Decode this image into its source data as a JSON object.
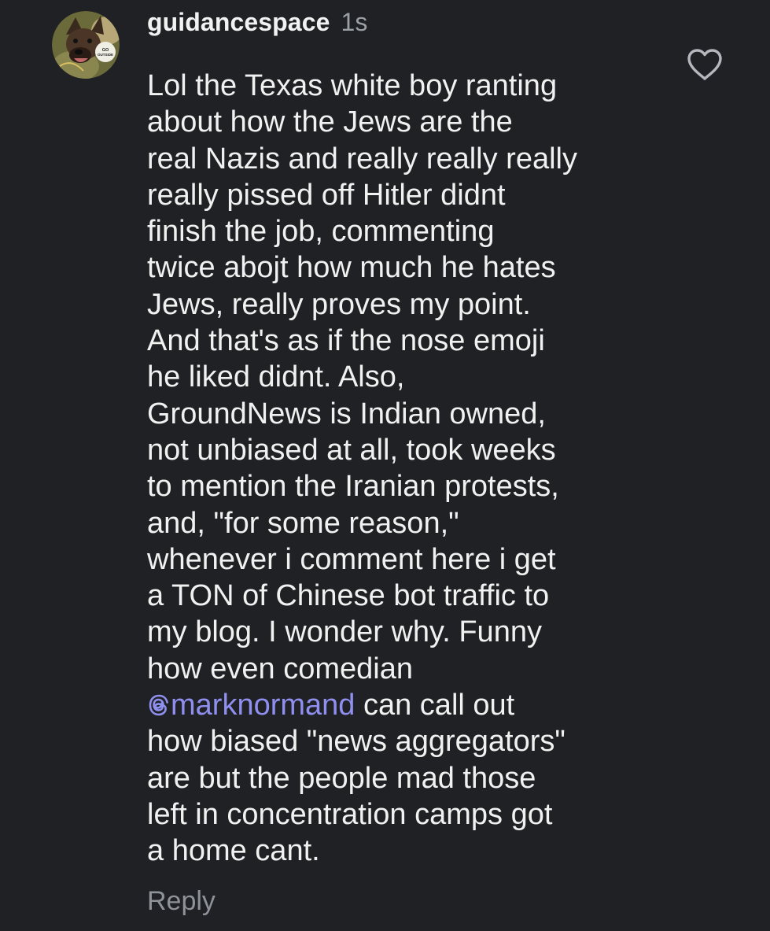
{
  "comment": {
    "username": "guidancespace",
    "timestamp": "1s",
    "avatar_text": "GO OUTSIDE",
    "lines": [
      "Lol the Texas white boy ranting",
      "about how the Jews are the",
      "real Nazis and really really really",
      "really pissed off Hitler didnt",
      "finish the job, commenting",
      "twice abojt how much he hates",
      "Jews, really proves my point.",
      "And that's as if the nose emoji",
      "he liked didnt. Also,",
      "GroundNews is Indian owned,",
      "not unbiased at all, took weeks",
      "to mention the Iranian protests,",
      "and, \"for some reason,\"",
      "whenever i comment here i get",
      "a TON of Chinese bot traffic to",
      "my blog. I wonder why. Funny",
      "how even comedian"
    ],
    "mention": "marknormand",
    "mention_suffix": " can call out",
    "lines_after": [
      "how biased \"news aggregators\"",
      "are but the people mad those",
      "left in concentration camps got",
      "a home cant."
    ],
    "reply_label": "Reply",
    "like_icon": "heart-outline-icon",
    "mention_icon": "threads-at-icon"
  },
  "colors": {
    "background": "#202124",
    "text": "#f1f1f1",
    "muted": "#9aa0a6",
    "mention": "#8f8ff0"
  }
}
